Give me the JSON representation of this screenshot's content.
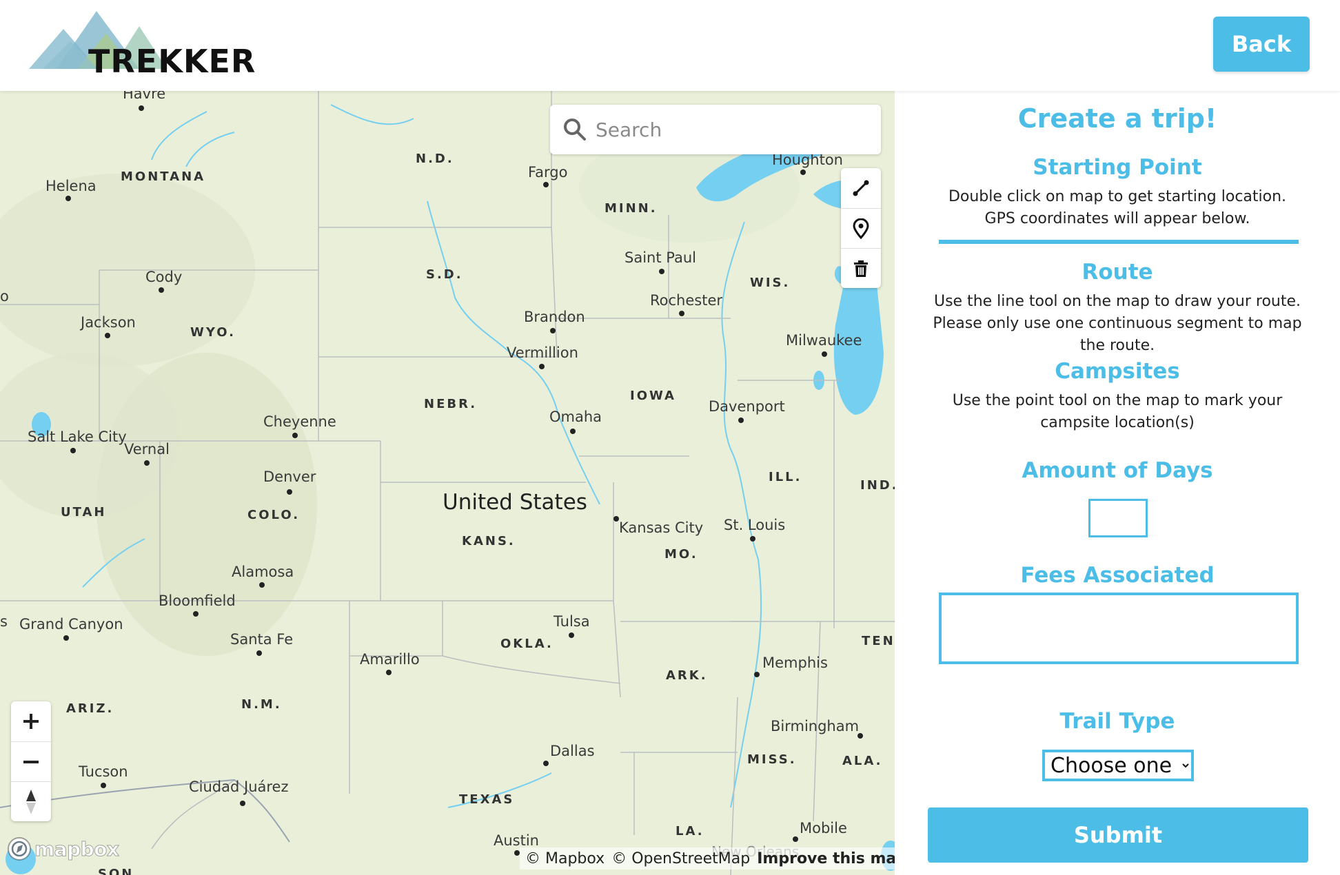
{
  "header": {
    "logo_text": "TREKKER",
    "back_label": "Back"
  },
  "map": {
    "search_placeholder": "Search",
    "country_label": "United States",
    "states": [
      {
        "id": "montana",
        "label": "MONTANA"
      },
      {
        "id": "nd",
        "label": "N.D."
      },
      {
        "id": "sd",
        "label": "S.D."
      },
      {
        "id": "minn",
        "label": "MINN."
      },
      {
        "id": "wis",
        "label": "WIS."
      },
      {
        "id": "wyo",
        "label": "WYO."
      },
      {
        "id": "nebr",
        "label": "NEBR."
      },
      {
        "id": "iowa",
        "label": "IOWA"
      },
      {
        "id": "ill",
        "label": "ILL."
      },
      {
        "id": "ind",
        "label": "IND."
      },
      {
        "id": "utah",
        "label": "UTAH"
      },
      {
        "id": "colo",
        "label": "COLO."
      },
      {
        "id": "kans",
        "label": "KANS."
      },
      {
        "id": "mo",
        "label": "MO."
      },
      {
        "id": "ten",
        "label": "TEN"
      },
      {
        "id": "okla",
        "label": "OKLA."
      },
      {
        "id": "ark",
        "label": "ARK."
      },
      {
        "id": "ariz",
        "label": "ARIZ."
      },
      {
        "id": "nm",
        "label": "N.M."
      },
      {
        "id": "miss",
        "label": "MISS."
      },
      {
        "id": "ala",
        "label": "ALA."
      },
      {
        "id": "texas",
        "label": "TEXAS"
      },
      {
        "id": "la",
        "label": "LA."
      }
    ],
    "cities": [
      {
        "id": "havre",
        "label": "Havre"
      },
      {
        "id": "helena",
        "label": "Helena"
      },
      {
        "id": "fargo",
        "label": "Fargo"
      },
      {
        "id": "houghton",
        "label": "Houghton"
      },
      {
        "id": "saint-paul",
        "label": "Saint Paul"
      },
      {
        "id": "cody",
        "label": "Cody"
      },
      {
        "id": "rochester",
        "label": "Rochester"
      },
      {
        "id": "jackson",
        "label": "Jackson"
      },
      {
        "id": "brandon",
        "label": "Brandon"
      },
      {
        "id": "milwaukee",
        "label": "Milwaukee"
      },
      {
        "id": "vermillion",
        "label": "Vermillion"
      },
      {
        "id": "cheyenne",
        "label": "Cheyenne"
      },
      {
        "id": "omaha",
        "label": "Omaha"
      },
      {
        "id": "davenport",
        "label": "Davenport"
      },
      {
        "id": "salt-lake-city",
        "label": "Salt Lake City"
      },
      {
        "id": "vernal",
        "label": "Vernal"
      },
      {
        "id": "denver",
        "label": "Denver"
      },
      {
        "id": "kansas-city",
        "label": "Kansas City"
      },
      {
        "id": "st-louis",
        "label": "St. Louis"
      },
      {
        "id": "alamosa",
        "label": "Alamosa"
      },
      {
        "id": "bloomfield",
        "label": "Bloomfield"
      },
      {
        "id": "grand-canyon",
        "label": "Grand Canyon"
      },
      {
        "id": "tulsa",
        "label": "Tulsa"
      },
      {
        "id": "santa-fe",
        "label": "Santa Fe"
      },
      {
        "id": "amarillo",
        "label": "Amarillo"
      },
      {
        "id": "memphis",
        "label": "Memphis"
      },
      {
        "id": "birmingham",
        "label": "Birmingham"
      },
      {
        "id": "dallas",
        "label": "Dallas"
      },
      {
        "id": "tucson",
        "label": "Tucson"
      },
      {
        "id": "ciudad-juarez",
        "label": "Ciudad Juárez"
      },
      {
        "id": "mobile",
        "label": "Mobile"
      },
      {
        "id": "austin",
        "label": "Austin"
      },
      {
        "id": "new-orleans",
        "label": "New Orleans"
      }
    ],
    "edge_fragments": [
      {
        "id": "frag-o",
        "label": "o"
      },
      {
        "id": "frag-s",
        "label": "s"
      },
      {
        "id": "frag-son",
        "label": "SON"
      }
    ],
    "attribution": {
      "mapbox": "© Mapbox",
      "osm": "© OpenStreetMap",
      "improve": "Improve this map"
    },
    "mapbox_logo_text": "mapbox"
  },
  "panel": {
    "title": "Create a trip!",
    "starting_point": {
      "heading": "Starting Point",
      "line1": "Double click on map to get starting location.",
      "line2": "GPS coordinates will appear below."
    },
    "route": {
      "heading": "Route",
      "line1": "Use the line tool on the map to draw your route.",
      "line2": "Please only use one continuous segment to map",
      "line3": "the route."
    },
    "campsites": {
      "heading": "Campsites",
      "line1": "Use the point tool on the map to mark your",
      "line2": "campsite location(s)"
    },
    "days_heading": "Amount of Days",
    "days_value": "",
    "fees_heading": "Fees Associated",
    "fees_value": "",
    "trail_heading": "Trail Type",
    "trail_selected": "Choose one",
    "submit_label": "Submit"
  },
  "colors": {
    "accent": "#4cbde6",
    "map_land": "#e9efd9",
    "map_water": "#75cff0"
  }
}
